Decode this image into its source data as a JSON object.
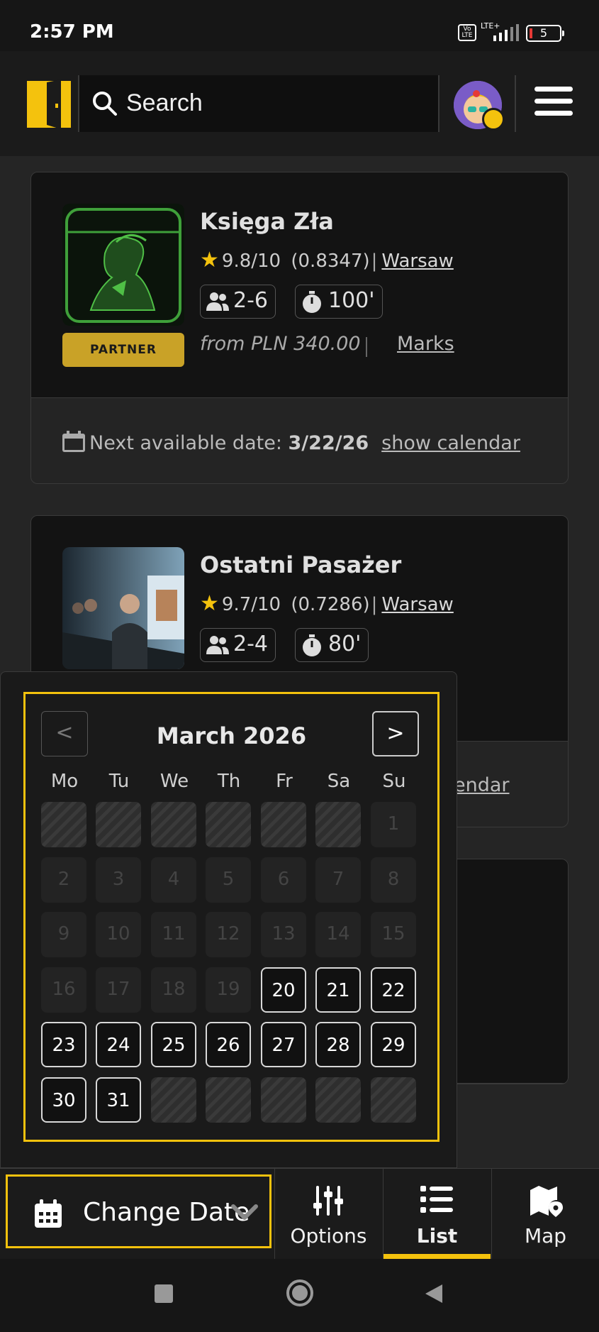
{
  "status": {
    "time": "2:57 PM",
    "volte": "Vo LTE",
    "network": "LTE+",
    "battery": "5"
  },
  "header": {
    "search_placeholder": "Search"
  },
  "cards": [
    {
      "title": "Księga Zła",
      "rating": "9.8/10",
      "rating_count": "(0.8347)",
      "city": "Warsaw",
      "players": "2-6",
      "duration": "100'",
      "badge": "PARTNER",
      "price": "from PLN 340.00",
      "marks": "Marks",
      "next_label": "Next available date:",
      "next_date": "3/22/26",
      "show_calendar": "show calendar"
    },
    {
      "title": "Ostatni Pasażer",
      "rating": "9.7/10",
      "rating_count": "(0.7286)",
      "city": "Warsaw",
      "players": "2-4",
      "duration": "80'",
      "show_calendar_partial": "endar"
    }
  ],
  "calendar": {
    "month": "March 2026",
    "prev": "<",
    "next": ">",
    "weekdays": [
      "Mo",
      "Tu",
      "We",
      "Th",
      "Fr",
      "Sa",
      "Su"
    ],
    "weeks": [
      [
        {
          "d": "",
          "s": "striped"
        },
        {
          "d": "",
          "s": "striped"
        },
        {
          "d": "",
          "s": "striped"
        },
        {
          "d": "",
          "s": "striped"
        },
        {
          "d": "",
          "s": "striped"
        },
        {
          "d": "",
          "s": "striped"
        },
        {
          "d": "1",
          "s": "disabled"
        }
      ],
      [
        {
          "d": "2",
          "s": "disabled"
        },
        {
          "d": "3",
          "s": "disabled"
        },
        {
          "d": "4",
          "s": "disabled"
        },
        {
          "d": "5",
          "s": "disabled"
        },
        {
          "d": "6",
          "s": "disabled"
        },
        {
          "d": "7",
          "s": "disabled"
        },
        {
          "d": "8",
          "s": "disabled"
        }
      ],
      [
        {
          "d": "9",
          "s": "disabled"
        },
        {
          "d": "10",
          "s": "disabled"
        },
        {
          "d": "11",
          "s": "disabled"
        },
        {
          "d": "12",
          "s": "disabled"
        },
        {
          "d": "13",
          "s": "disabled"
        },
        {
          "d": "14",
          "s": "disabled"
        },
        {
          "d": "15",
          "s": "disabled"
        }
      ],
      [
        {
          "d": "16",
          "s": "disabled"
        },
        {
          "d": "17",
          "s": "disabled"
        },
        {
          "d": "18",
          "s": "disabled"
        },
        {
          "d": "19",
          "s": "disabled"
        },
        {
          "d": "20",
          "s": "avail"
        },
        {
          "d": "21",
          "s": "avail"
        },
        {
          "d": "22",
          "s": "avail"
        }
      ],
      [
        {
          "d": "23",
          "s": "avail"
        },
        {
          "d": "24",
          "s": "avail"
        },
        {
          "d": "25",
          "s": "avail"
        },
        {
          "d": "26",
          "s": "avail"
        },
        {
          "d": "27",
          "s": "avail"
        },
        {
          "d": "28",
          "s": "avail"
        },
        {
          "d": "29",
          "s": "avail"
        }
      ],
      [
        {
          "d": "30",
          "s": "avail"
        },
        {
          "d": "31",
          "s": "avail"
        },
        {
          "d": "",
          "s": "striped"
        },
        {
          "d": "",
          "s": "striped"
        },
        {
          "d": "",
          "s": "striped"
        },
        {
          "d": "",
          "s": "striped"
        },
        {
          "d": "",
          "s": "striped"
        }
      ]
    ]
  },
  "bottom_nav": {
    "change_date": "Change Date",
    "options": "Options",
    "list": "List",
    "map": "Map"
  },
  "colors": {
    "accent": "#f4c20d",
    "partner": "#c9a227",
    "background": "#252525"
  }
}
